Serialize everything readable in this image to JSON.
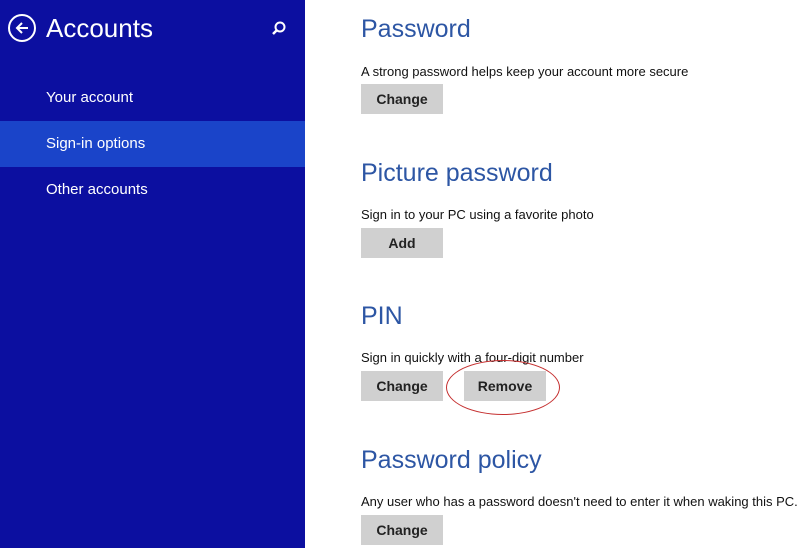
{
  "sidebar": {
    "title": "Accounts",
    "items": [
      {
        "label": "Your account"
      },
      {
        "label": "Sign-in options"
      },
      {
        "label": "Other accounts"
      }
    ]
  },
  "sections": {
    "password": {
      "title": "Password",
      "description": "A strong password helps keep your account more secure",
      "change_label": "Change"
    },
    "picture_password": {
      "title": "Picture password",
      "description": "Sign in to your PC using a favorite photo",
      "add_label": "Add"
    },
    "pin": {
      "title": "PIN",
      "description": "Sign in quickly with a four-digit number",
      "change_label": "Change",
      "remove_label": "Remove"
    },
    "password_policy": {
      "title": "Password policy",
      "description": "Any user who has a password doesn't need to enter it when waking this PC.",
      "change_label": "Change"
    }
  },
  "icons": {
    "back": "back-arrow-circle-icon",
    "search": "search-icon"
  },
  "colors": {
    "sidebar_bg": "#0c0fa0",
    "sidebar_selected": "#1a44c9",
    "section_title": "#2d56a4",
    "button_bg": "#d0d0d0",
    "annotation": "#c53030"
  }
}
